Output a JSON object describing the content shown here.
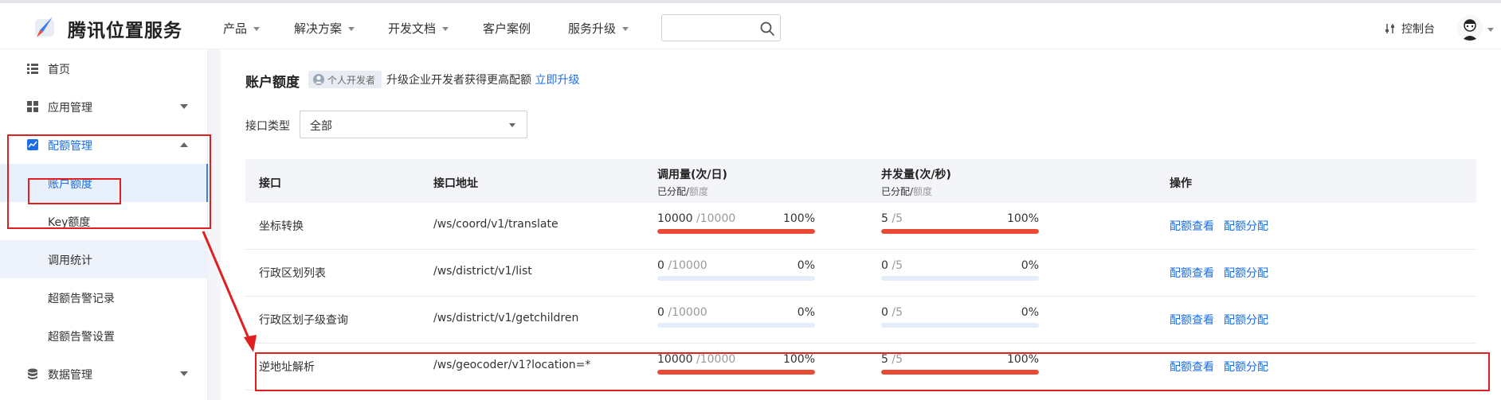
{
  "header": {
    "brand": "腾讯位置服务",
    "nav": [
      "产品",
      "解决方案",
      "开发文档",
      "客户案例",
      "服务升级"
    ],
    "search": {
      "value": "",
      "placeholder": ""
    },
    "console_label": "控制台"
  },
  "sidebar": {
    "items": [
      {
        "label": "首页",
        "icon": "home-list-icon"
      },
      {
        "label": "应用管理",
        "icon": "grid-icon"
      },
      {
        "label": "配额管理",
        "icon": "chart-icon"
      },
      {
        "label": "账户额度"
      },
      {
        "label": "Key额度"
      },
      {
        "label": "调用统计"
      },
      {
        "label": "超额告警记录"
      },
      {
        "label": "超额告警设置"
      },
      {
        "label": "数据管理",
        "icon": "database-icon"
      }
    ]
  },
  "main": {
    "title": "账户额度",
    "badge": "个人开发者",
    "upgrade_tip": "升级企业开发者获得更高配额",
    "upgrade_link": "立即升级",
    "filter": {
      "label": "接口类型",
      "value": "全部"
    },
    "table": {
      "headers": {
        "api": "接口",
        "address": "接口地址",
        "calls": "调用量(次/日)",
        "concurrency": "并发量(次/秒)",
        "allocated": "已分配/",
        "quota": "额度",
        "ops": "操作"
      },
      "rows": [
        {
          "api": "坐标转换",
          "address": "/ws/coord/v1/translate",
          "calls_used": "10000",
          "calls_total": "/10000",
          "calls_pct": "100%",
          "calls_fill": 1.0,
          "conc_used": "5",
          "conc_total": "/5",
          "conc_pct": "100%",
          "conc_fill": 1.0
        },
        {
          "api": "行政区划列表",
          "address": "/ws/district/v1/list",
          "calls_used": "0",
          "calls_total": "/10000",
          "calls_pct": "0%",
          "calls_fill": 0.0,
          "conc_used": "0",
          "conc_total": "/5",
          "conc_pct": "0%",
          "conc_fill": 0.0
        },
        {
          "api": "行政区划子级查询",
          "address": "/ws/district/v1/getchildren",
          "calls_used": "0",
          "calls_total": "/10000",
          "calls_pct": "0%",
          "calls_fill": 0.0,
          "conc_used": "0",
          "conc_total": "/5",
          "conc_pct": "0%",
          "conc_fill": 0.0
        },
        {
          "api": "逆地址解析",
          "address": "/ws/geocoder/v1?location=*",
          "calls_used": "10000",
          "calls_total": "/10000",
          "calls_pct": "100%",
          "calls_fill": 1.0,
          "conc_used": "5",
          "conc_total": "/5",
          "conc_pct": "100%",
          "conc_fill": 1.0
        }
      ],
      "actions": {
        "view": "配额查看",
        "allocate": "配额分配"
      }
    }
  },
  "colors": {
    "accent": "#1b6ee8",
    "bar_fill": "#ea4a35",
    "bar_track": "#e4eefb",
    "annotation": "#e02020"
  }
}
